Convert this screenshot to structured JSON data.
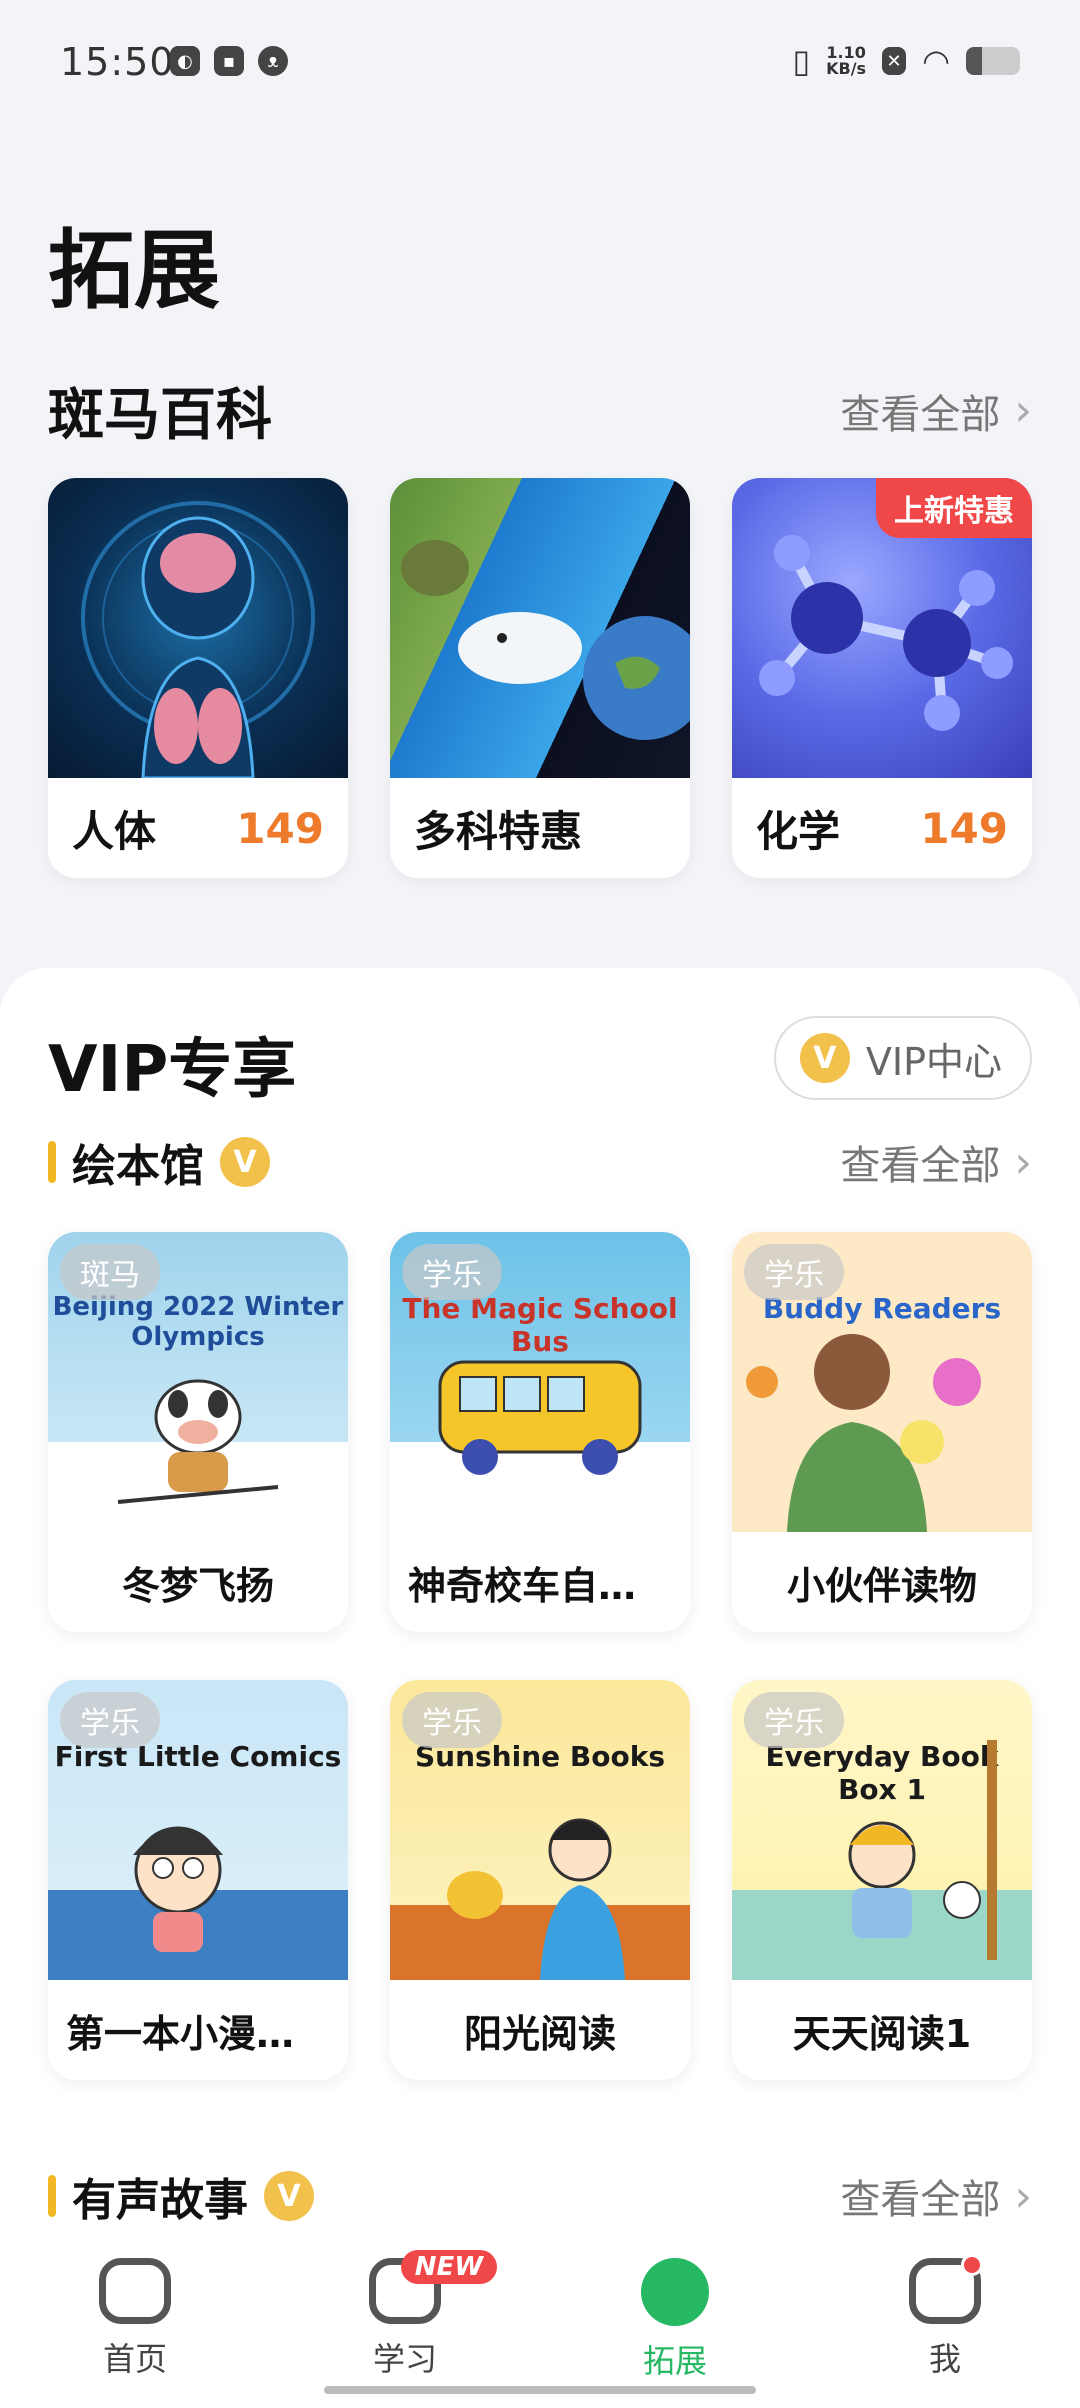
{
  "status_bar": {
    "time": "15:50",
    "net_speed_value": "1.10",
    "net_speed_unit": "KB/s",
    "battery_level": 0.3,
    "icons": [
      "app-icon",
      "message-icon",
      "cat-icon",
      "vibrate-icon",
      "sim-off-icon",
      "wifi-icon",
      "battery-icon"
    ]
  },
  "page": {
    "title": "拓展"
  },
  "encyclopedia": {
    "title": "斑马百科",
    "view_all": "查看全部",
    "items": [
      {
        "name": "人体",
        "price": "149",
        "tag": ""
      },
      {
        "name": "多科特惠",
        "price": "",
        "tag": ""
      },
      {
        "name": "化学",
        "price": "149",
        "tag": "上新特惠"
      }
    ]
  },
  "vip": {
    "title": "VIP专享",
    "center_label": "VIP中心",
    "badge_letter": "V",
    "picture_books": {
      "title": "绘本馆",
      "view_all": "查看全部",
      "items": [
        {
          "name": "冬梦飞扬",
          "publisher": "斑马",
          "art_title": "Beijing 2022 Winter Olympics"
        },
        {
          "name": "神奇校车自然…",
          "publisher": "学乐",
          "art_title": "The Magic School Bus"
        },
        {
          "name": "小伙伴读物",
          "publisher": "学乐",
          "art_title": "Buddy Readers"
        },
        {
          "name": "第一本小漫画书",
          "publisher": "学乐",
          "art_title": "First Little Comics"
        },
        {
          "name": "阳光阅读",
          "publisher": "学乐",
          "art_title": "Sunshine Books"
        },
        {
          "name": "天天阅读1",
          "publisher": "学乐",
          "art_title": "Everyday Book Box 1"
        }
      ]
    },
    "audio_stories": {
      "title": "有声故事",
      "view_all": "查看全部"
    }
  },
  "tab_bar": {
    "tabs": [
      {
        "label": "首页",
        "active": false,
        "badge": ""
      },
      {
        "label": "学习",
        "active": false,
        "badge": "NEW"
      },
      {
        "label": "拓展",
        "active": true,
        "badge": ""
      },
      {
        "label": "我",
        "active": false,
        "badge": "dot"
      }
    ]
  },
  "colors": {
    "accent_green": "#27b864",
    "price_orange": "#ee7a2c",
    "badge_red": "#f04848",
    "vip_gold": "#f2c14b"
  }
}
